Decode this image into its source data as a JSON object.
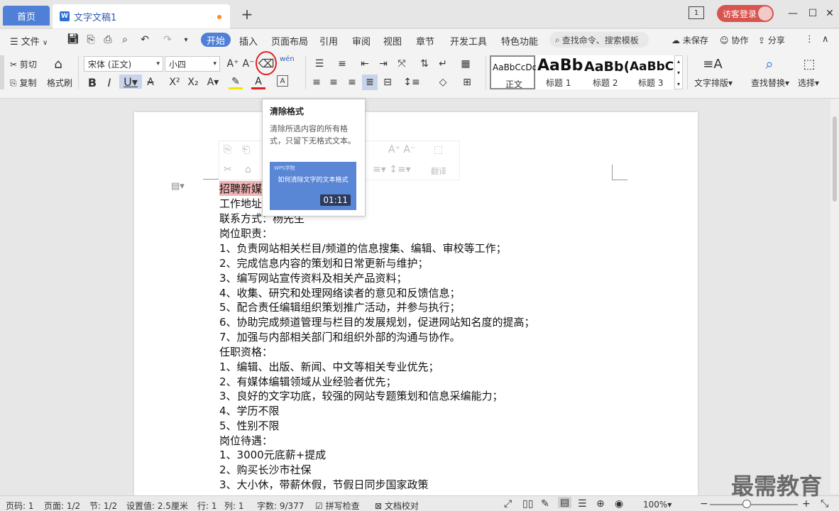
{
  "tabs": {
    "home": "首页",
    "doc_title": "文字文稿1",
    "doc_icon": "W",
    "add": "+"
  },
  "account": {
    "login": "访客登录",
    "page_indicator": "1"
  },
  "menu": {
    "file": "文件",
    "items": [
      "开始",
      "插入",
      "页面布局",
      "引用",
      "审阅",
      "视图",
      "章节",
      "开发工具",
      "特色功能"
    ],
    "search": "查找命令、搜索模板",
    "unsaved": "未保存",
    "collab": "协作",
    "share": "分享"
  },
  "ribbon": {
    "cut": "剪切",
    "copy": "复制",
    "format_painter": "格式刷",
    "font_name": "宋体 (正文)",
    "font_size": "小四",
    "pinyin": "wén",
    "styles": [
      {
        "sample": "AaBbCcDd",
        "label": "正文"
      },
      {
        "sample": "AaBb",
        "label": "标题 1"
      },
      {
        "sample": "AaBb(",
        "label": "标题 2"
      },
      {
        "sample": "AaBbC",
        "label": "标题 3"
      }
    ],
    "text_layout": "文字排版",
    "find_replace": "查找替换",
    "select": "选择"
  },
  "tooltip": {
    "title": "清除格式",
    "desc": "清除所选内容的所有格式，只留下无格式文本。",
    "video_logo": "WPS学院",
    "video_title": "如何清除文字的文本格式",
    "duration": "01:11"
  },
  "minibar": {
    "sort_label": "翻译"
  },
  "doc": {
    "lines": [
      "招聘新媒",
      "工作地址",
      "联系方式：杨先生",
      "岗位职责：",
      "1、负责网站相关栏目/频道的信息搜集、编辑、审校等工作；",
      "2、完成信息内容的策划和日常更新与维护；",
      "3、编写网站宣传资料及相关产品资料；",
      "4、收集、研究和处理网络读者的意见和反馈信息；",
      "5、配合责任编辑组织策划推广活动，并参与执行；",
      "6、协助完成频道管理与栏目的发展规划，促进网站知名度的提高；",
      "7、加强与内部相关部门和组织外部的沟通与协作。",
      "任职资格：",
      "1、编辑、出版、新闻、中文等相关专业优先；",
      "2、有媒体编辑领域从业经验者优先；",
      "3、良好的文字功底，较强的网站专题策划和信息采编能力；",
      "4、学历不限",
      "5、性别不限",
      "岗位待遇：",
      "1、3000元底薪+提成",
      "2、购买长沙市社保",
      "3、大小休，带薪休假，节假日同步国家政策"
    ]
  },
  "status": {
    "page": "页码: 1",
    "pages": "页面: 1/2",
    "section": "节: 1/2",
    "setting": "设置值: 2.5厘米",
    "row": "行: 1",
    "col": "列: 1",
    "words": "字数: 9/377",
    "spell": "拼写检查",
    "proof": "文档校对",
    "zoom": "100%"
  },
  "watermark": "最需教育",
  "colors": {
    "accent": "#4f7fd6",
    "login": "#d9534f",
    "highlight": "#f1b4b4",
    "circle": "#e02020"
  }
}
